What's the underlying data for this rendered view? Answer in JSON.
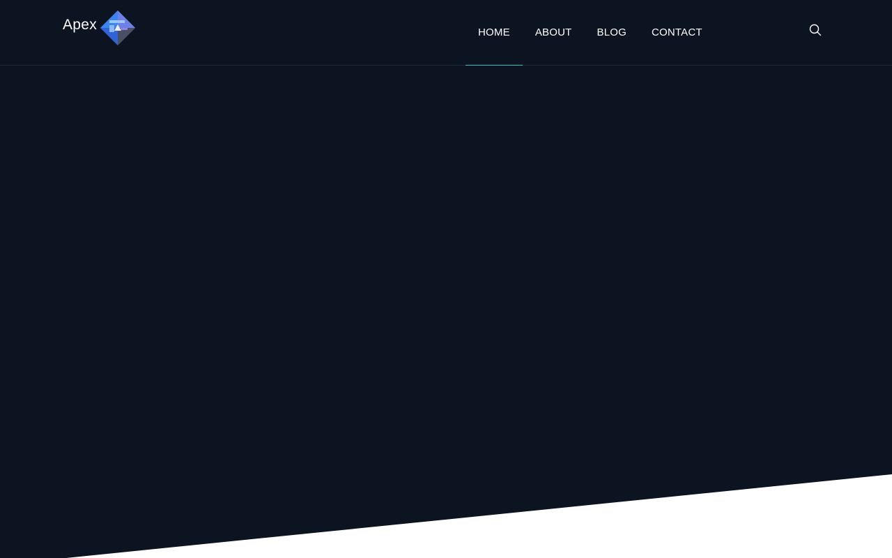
{
  "colors": {
    "hero_background": "#0c1421",
    "accent": "#2fc3cf",
    "nav_text": "#ffffff",
    "lower_background": "#ffffff"
  },
  "header": {
    "logo": {
      "text": "Apex",
      "icon": "diamond-logo-icon"
    },
    "nav": [
      {
        "label": "HOME",
        "active": true
      },
      {
        "label": "ABOUT",
        "active": false
      },
      {
        "label": "BLOG",
        "active": false
      },
      {
        "label": "CONTACT",
        "active": false
      }
    ],
    "search": {
      "icon": "search-icon"
    }
  }
}
